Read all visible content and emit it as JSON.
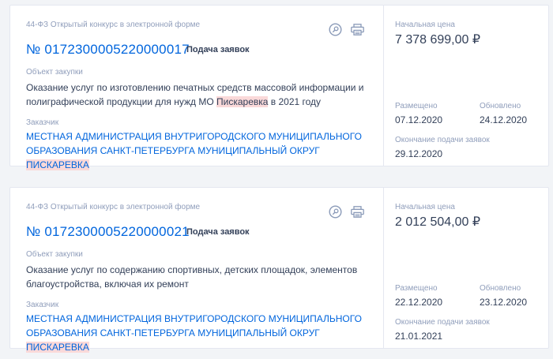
{
  "colors": {
    "link": "#0065dd",
    "muted": "#909ebb",
    "text": "#334059",
    "highlight": "#fad9d9"
  },
  "cards": [
    {
      "type": "44-ФЗ Открытый конкурс в электронной форме",
      "number": "№ 0172300005220000017",
      "status": "Подача заявок",
      "object_label": "Объект закупки",
      "object_pre": "Оказание услуг по изготовлению печатных средств массовой информации и полиграфической продукции для нужд МО ",
      "object_hl": "Пискаревка",
      "object_post": " в 2021 году",
      "customer_label": "Заказчик",
      "customer_pre": "МЕСТНАЯ АДМИНИСТРАЦИЯ ВНУТРИГОРОДСКОГО МУНИЦИПАЛЬНОГО ОБРАЗОВАНИЯ САНКТ-ПЕТЕРБУРГА МУНИЦИПАЛЬНЫЙ ОКРУГ ",
      "customer_hl": "ПИСКАРЕВКА",
      "price_label": "Начальная цена",
      "price": "7 378 699,00 ₽",
      "placed_label": "Размещено",
      "placed": "07.12.2020",
      "updated_label": "Обновлено",
      "updated": "24.12.2020",
      "end_label": "Окончание подачи заявок",
      "end": "29.12.2020",
      "icons": [
        "search-document-icon",
        "printer-icon"
      ]
    },
    {
      "type": "44-ФЗ Открытый конкурс в электронной форме",
      "number": "№ 0172300005220000021",
      "status": "Подача заявок",
      "object_label": "Объект закупки",
      "object_pre": "Оказание услуг по содержанию спортивных, детских площадок, элементов благоустройства, включая их ремонт",
      "object_hl": "",
      "object_post": "",
      "customer_label": "Заказчик",
      "customer_pre": "МЕСТНАЯ АДМИНИСТРАЦИЯ ВНУТРИГОРОДСКОГО МУНИЦИПАЛЬНОГО ОБРАЗОВАНИЯ САНКТ-ПЕТЕРБУРГА МУНИЦИПАЛЬНЫЙ ОКРУГ ",
      "customer_hl": "ПИСКАРЕВКА",
      "price_label": "Начальная цена",
      "price": "2 012 504,00 ₽",
      "placed_label": "Размещено",
      "placed": "22.12.2020",
      "updated_label": "Обновлено",
      "updated": "23.12.2020",
      "end_label": "Окончание подачи заявок",
      "end": "21.01.2021",
      "icons": [
        "search-document-icon",
        "printer-icon"
      ]
    }
  ]
}
